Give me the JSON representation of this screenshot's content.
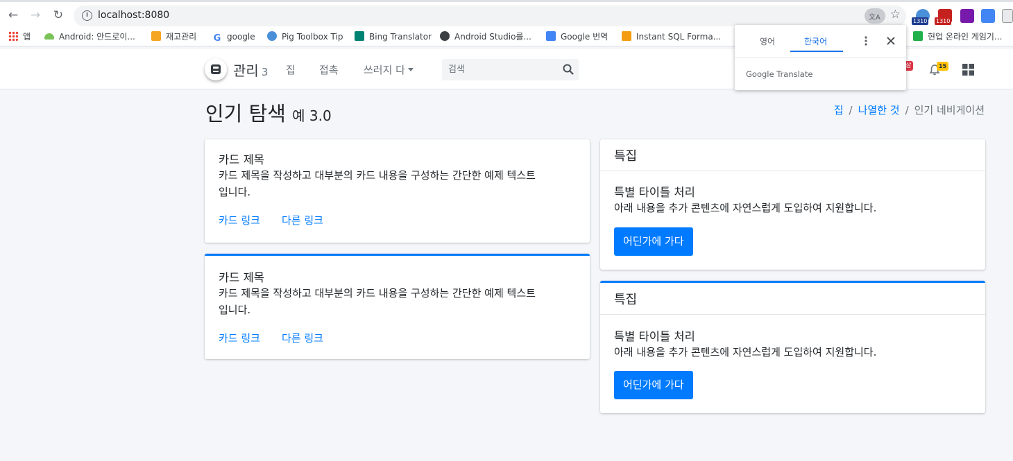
{
  "browser": {
    "url": "localhost:8080",
    "bookmarks": [
      {
        "label": "앱",
        "icon": "apps-grid-icon"
      },
      {
        "label": "Android: 안드로이...",
        "icon": "android-icon"
      },
      {
        "label": "재고관리",
        "icon": "inventory-icon"
      },
      {
        "label": "google",
        "icon": "google-icon"
      },
      {
        "label": "Pig Toolbox Tip",
        "icon": "globe-icon"
      },
      {
        "label": "Bing Translator",
        "icon": "bing-icon"
      },
      {
        "label": "Android Studio를...",
        "icon": "globe-dark-icon"
      },
      {
        "label": "Google 번역",
        "icon": "google-translate-icon"
      },
      {
        "label": "Instant SQL Forma...",
        "icon": "sql-icon"
      },
      {
        "label": "현업 온라인 게임기...",
        "icon": "game-icon"
      }
    ],
    "ext_badges": [
      "1310",
      "1310"
    ]
  },
  "translate_popup": {
    "tab_source": "영어",
    "tab_target": "한국어",
    "brand": "Google Translate"
  },
  "header": {
    "brand": "관리",
    "brand_version": "3",
    "nav": [
      "집",
      "접촉",
      "쓰러지 다"
    ],
    "search_placeholder": "검색",
    "message_badge": "삼",
    "notification_count": "15"
  },
  "page": {
    "title": "인기 탐색",
    "title_small": "예 3.0",
    "breadcrumb": [
      "집",
      "나열한 것",
      "인기 네비게이션"
    ]
  },
  "cards_left": [
    {
      "title": "카드 제목",
      "text_line1": "카드 제목을 작성하고 대부분의 카드 내용을 구성하는 간단한 예제 텍스트",
      "text_line2": "입니다.",
      "link1": "카드 링크",
      "link2": "다른 링크"
    },
    {
      "title": "카드 제목",
      "text_line1": "카드 제목을 작성하고 대부분의 카드 내용을 구성하는 간단한 예제 텍스트",
      "text_line2": "입니다.",
      "link1": "카드 링크",
      "link2": "다른 링크"
    }
  ],
  "cards_right": [
    {
      "header": "특집",
      "title": "특별 타이틀 처리",
      "text": "아래 내용을 추가 콘텐츠에 자연스럽게 도입하여 지원합니다.",
      "button": "어딘가에 가다"
    },
    {
      "header": "특집",
      "title": "특별 타이틀 처리",
      "text": "아래 내용을 추가 콘텐츠에 자연스럽게 도입하여 지원합니다.",
      "button": "어딘가에 가다"
    }
  ],
  "colors": {
    "primary": "#007bff",
    "background": "#f4f6f9",
    "danger": "#dc3545",
    "warning": "#ffc107"
  }
}
